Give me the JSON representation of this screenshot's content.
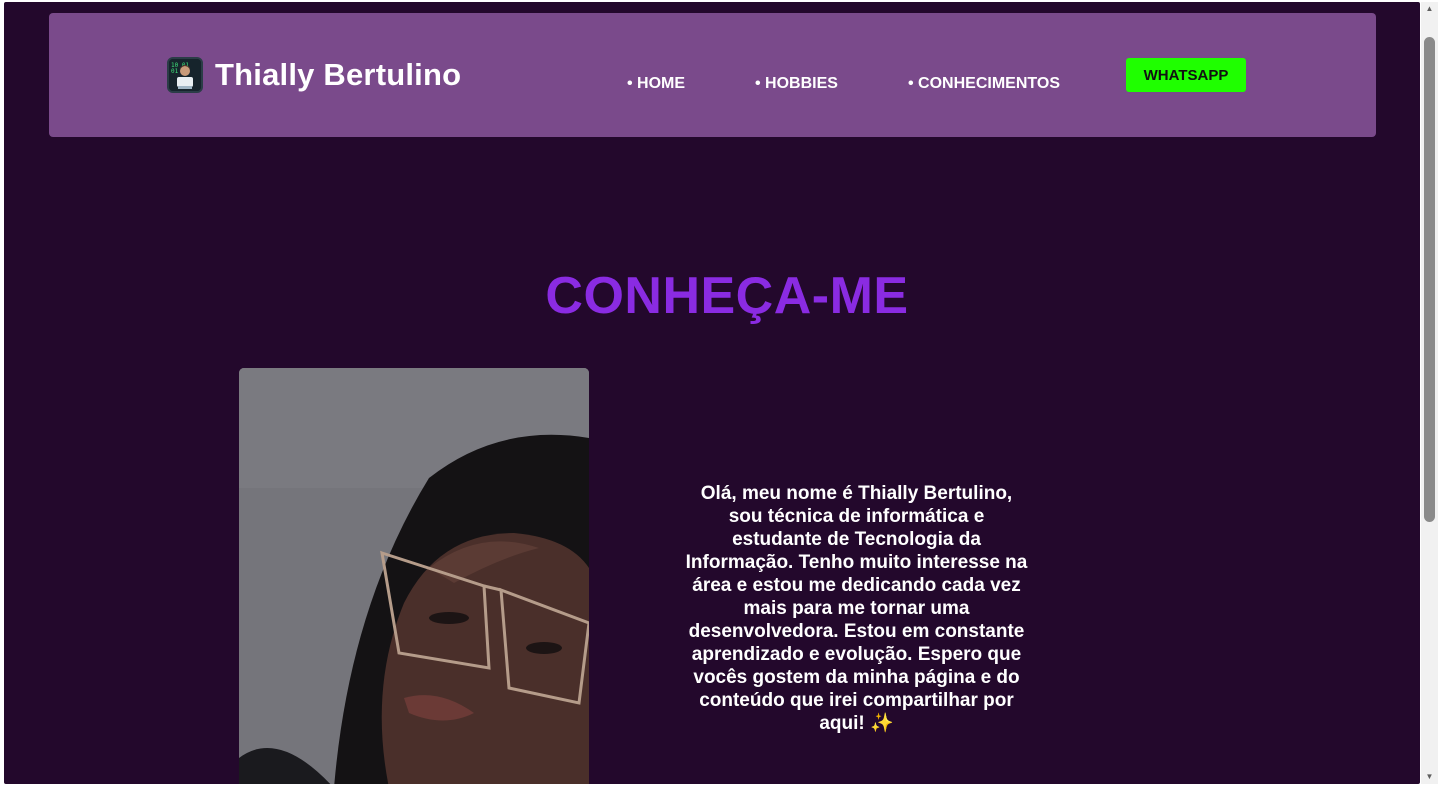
{
  "header": {
    "brand_icon": "technologist-emoji-icon",
    "brand_title": "Thially Bertulino",
    "nav": [
      {
        "label": "• HOME"
      },
      {
        "label": "• HOBBIES"
      },
      {
        "label": "• CONHECIMENTOS"
      }
    ],
    "cta_label": "WHATSAPP"
  },
  "about": {
    "title": "CONHEÇA-ME",
    "photo_icon": "profile-photo",
    "bio_text": "Olá, meu nome é Thially Bertulino, sou técnica de informática e estudante de Tecnologia da Informação. Tenho muito interesse na área e estou me dedicando cada vez mais para me tornar uma desenvolvedora. Estou em constante aprendizado e evolução. Espero que vocês gostem da minha página e do conteúdo que irei compartilhar por aqui!",
    "bio_emoji": "✨"
  },
  "colors": {
    "page_bg": "#23082c",
    "navbar_bg": "#7a4a8b",
    "title_purple": "#8a2be2",
    "whatsapp_green": "#1fff00"
  }
}
